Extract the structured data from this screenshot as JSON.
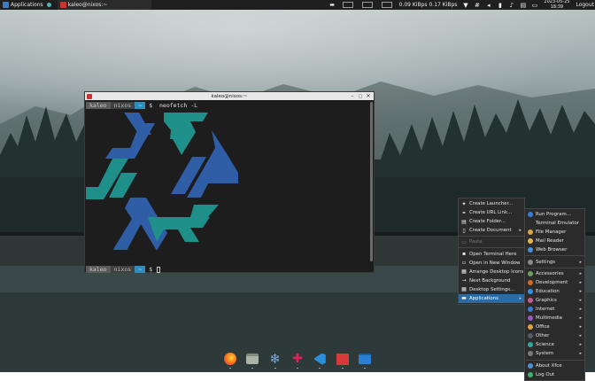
{
  "top_panel": {
    "applications_label": "Applications",
    "window_label": "kaleo@nixos:~",
    "net_speed": "0.09 KiBps 0.17 KiBps",
    "date": "2023-05-25",
    "time": "18:39",
    "logout_label": "Logout",
    "icons": [
      "xfce-icon",
      "terminal-app-icon",
      "workspace-1-icon",
      "workspace-2-icon",
      "workspace-3-icon",
      "wifi-icon",
      "grid-icon",
      "volume-icon",
      "battery-icon",
      "notification-bell-icon",
      "clipboard-icon",
      "display-icon"
    ]
  },
  "terminal": {
    "title": "kaleo@nixos:~",
    "prompt": {
      "user": "kaleo",
      "host": "nixos",
      "dir": "~",
      "symbol": "$"
    },
    "command": "neofetch -L",
    "logo_colors": {
      "blue": "#2f5ea7",
      "teal": "#1f8f8a"
    },
    "background": "#1d1d1d"
  },
  "desktop_menu": {
    "items": [
      {
        "label": "Create Launcher...",
        "icon": "launcher-icon",
        "disabled": false
      },
      {
        "label": "Create URL Link...",
        "icon": "link-icon",
        "disabled": false
      },
      {
        "label": "Create Folder...",
        "icon": "folder-icon",
        "disabled": false
      },
      {
        "label": "Create Document",
        "icon": "document-icon",
        "submenu": true,
        "disabled": false
      },
      {
        "sep": true
      },
      {
        "label": "Paste",
        "icon": "paste-icon",
        "disabled": true
      },
      {
        "sep": true
      },
      {
        "label": "Open Terminal Here",
        "icon": "terminal-icon",
        "disabled": false
      },
      {
        "label": "Open in New Window",
        "icon": "window-icon",
        "disabled": false
      },
      {
        "label": "Arrange Desktop Icons",
        "icon": "arrange-icon",
        "disabled": false
      },
      {
        "label": "Next Background",
        "icon": "next-icon",
        "disabled": false
      },
      {
        "label": "Desktop Settings...",
        "icon": "settings-icon",
        "disabled": false
      },
      {
        "label": "Applications",
        "icon": "apps-icon",
        "submenu": true,
        "active": true
      }
    ]
  },
  "applications_menu": {
    "items": [
      {
        "label": "Run Program...",
        "color": "#3a7bd5",
        "submenu": false
      },
      {
        "label": "Terminal Emulator",
        "color": "#2a2a2a",
        "submenu": false
      },
      {
        "label": "File Manager",
        "color": "#d9a441",
        "submenu": false
      },
      {
        "label": "Mail Reader",
        "color": "#e0b64a",
        "submenu": false
      },
      {
        "label": "Web Browser",
        "color": "#4a90d9",
        "submenu": false
      },
      {
        "sep": true
      },
      {
        "label": "Settings",
        "color": "#8a8a8a",
        "submenu": true
      },
      {
        "sep": true
      },
      {
        "label": "Accessories",
        "color": "#6ca05c",
        "submenu": true
      },
      {
        "label": "Development",
        "color": "#d06a2a",
        "submenu": true
      },
      {
        "label": "Education",
        "color": "#3b8ee0",
        "submenu": true
      },
      {
        "label": "Graphics",
        "color": "#c55a8f",
        "submenu": true
      },
      {
        "label": "Internet",
        "color": "#3a7bd5",
        "submenu": true
      },
      {
        "label": "Multimedia",
        "color": "#9b59b6",
        "submenu": true
      },
      {
        "label": "Office",
        "color": "#d9a441",
        "submenu": true
      },
      {
        "label": "Other",
        "color": "#555b66",
        "submenu": true
      },
      {
        "label": "Science",
        "color": "#2ba8a0",
        "submenu": true
      },
      {
        "label": "System",
        "color": "#7a7a7a",
        "submenu": true
      },
      {
        "sep": true
      },
      {
        "label": "About Xfce",
        "color": "#4a90d9",
        "submenu": false
      },
      {
        "label": "Log Out",
        "color": "#3cb371",
        "submenu": false
      }
    ]
  },
  "dock": {
    "items": [
      {
        "name": "firefox-icon",
        "color": "#ff6a1a"
      },
      {
        "name": "files-icon",
        "color": "#9aa79a"
      },
      {
        "name": "nix-snowflake-icon",
        "color": "#7ea9d8"
      },
      {
        "name": "slack-icon",
        "color": "#e8e8e8"
      },
      {
        "name": "vscode-icon",
        "color": "#2c8fdc"
      },
      {
        "name": "book-app-icon",
        "color": "#d83a3a"
      },
      {
        "name": "window-app-icon",
        "color": "#2b7fd3"
      }
    ]
  }
}
